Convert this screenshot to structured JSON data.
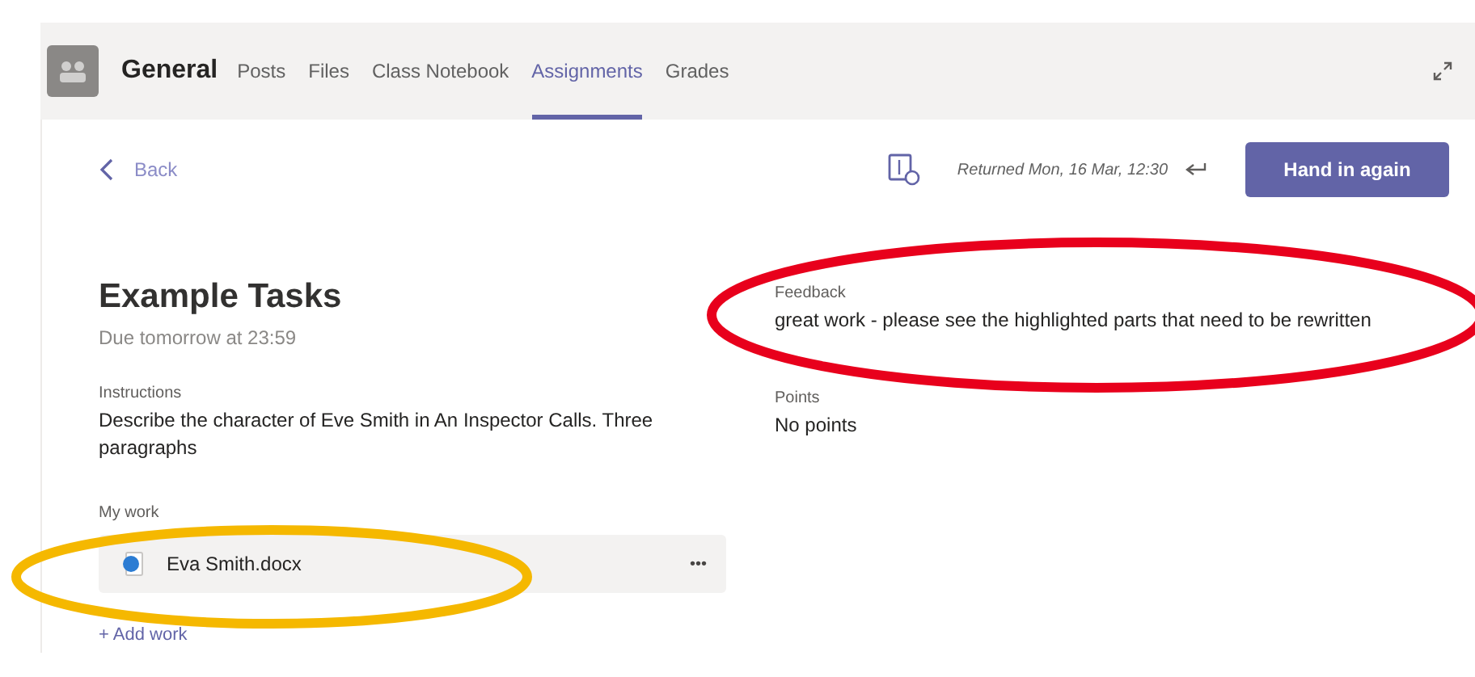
{
  "header": {
    "team": "General",
    "tabs": [
      {
        "label": "Posts",
        "selected": false
      },
      {
        "label": "Files",
        "selected": false
      },
      {
        "label": "Class Notebook",
        "selected": false
      },
      {
        "label": "Assignments",
        "selected": true
      },
      {
        "label": "Grades",
        "selected": false
      }
    ]
  },
  "back": "Back",
  "status": "Returned Mon, 16 Mar, 12:30",
  "hand_in_button": "Hand in again",
  "assignment": {
    "title": "Example Tasks",
    "due": "Due tomorrow at 23:59",
    "instructions_label": "Instructions",
    "instructions": "Describe the character of Eve Smith in An Inspector Calls. Three paragraphs",
    "my_work_label": "My work",
    "files": [
      {
        "name": "Eva Smith.docx",
        "menu": "•••"
      }
    ],
    "add_work": "+ Add work"
  },
  "feedback": {
    "label": "Feedback",
    "text": "great work - please see the highlighted parts that need to be rewritten",
    "points_label": "Points",
    "points": "No points"
  },
  "annotations": [
    {
      "color": "#e8001c"
    },
    {
      "color": "#f5b800"
    }
  ]
}
